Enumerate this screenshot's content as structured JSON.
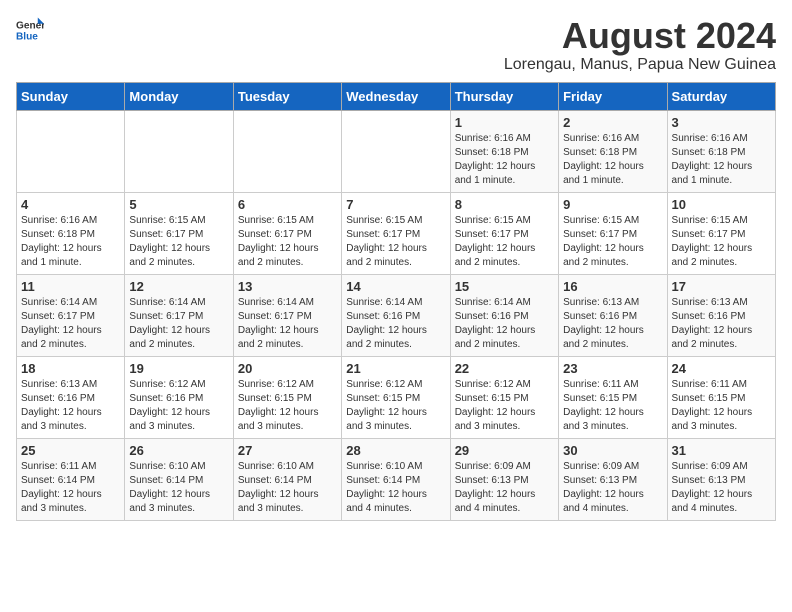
{
  "logo": {
    "general": "General",
    "blue": "Blue"
  },
  "title": "August 2024",
  "subtitle": "Lorengau, Manus, Papua New Guinea",
  "days_of_week": [
    "Sunday",
    "Monday",
    "Tuesday",
    "Wednesday",
    "Thursday",
    "Friday",
    "Saturday"
  ],
  "weeks": [
    [
      {
        "day": "",
        "info": ""
      },
      {
        "day": "",
        "info": ""
      },
      {
        "day": "",
        "info": ""
      },
      {
        "day": "",
        "info": ""
      },
      {
        "day": "1",
        "info": "Sunrise: 6:16 AM\nSunset: 6:18 PM\nDaylight: 12 hours\nand 1 minute."
      },
      {
        "day": "2",
        "info": "Sunrise: 6:16 AM\nSunset: 6:18 PM\nDaylight: 12 hours\nand 1 minute."
      },
      {
        "day": "3",
        "info": "Sunrise: 6:16 AM\nSunset: 6:18 PM\nDaylight: 12 hours\nand 1 minute."
      }
    ],
    [
      {
        "day": "4",
        "info": "Sunrise: 6:16 AM\nSunset: 6:18 PM\nDaylight: 12 hours\nand 1 minute."
      },
      {
        "day": "5",
        "info": "Sunrise: 6:15 AM\nSunset: 6:17 PM\nDaylight: 12 hours\nand 2 minutes."
      },
      {
        "day": "6",
        "info": "Sunrise: 6:15 AM\nSunset: 6:17 PM\nDaylight: 12 hours\nand 2 minutes."
      },
      {
        "day": "7",
        "info": "Sunrise: 6:15 AM\nSunset: 6:17 PM\nDaylight: 12 hours\nand 2 minutes."
      },
      {
        "day": "8",
        "info": "Sunrise: 6:15 AM\nSunset: 6:17 PM\nDaylight: 12 hours\nand 2 minutes."
      },
      {
        "day": "9",
        "info": "Sunrise: 6:15 AM\nSunset: 6:17 PM\nDaylight: 12 hours\nand 2 minutes."
      },
      {
        "day": "10",
        "info": "Sunrise: 6:15 AM\nSunset: 6:17 PM\nDaylight: 12 hours\nand 2 minutes."
      }
    ],
    [
      {
        "day": "11",
        "info": "Sunrise: 6:14 AM\nSunset: 6:17 PM\nDaylight: 12 hours\nand 2 minutes."
      },
      {
        "day": "12",
        "info": "Sunrise: 6:14 AM\nSunset: 6:17 PM\nDaylight: 12 hours\nand 2 minutes."
      },
      {
        "day": "13",
        "info": "Sunrise: 6:14 AM\nSunset: 6:17 PM\nDaylight: 12 hours\nand 2 minutes."
      },
      {
        "day": "14",
        "info": "Sunrise: 6:14 AM\nSunset: 6:16 PM\nDaylight: 12 hours\nand 2 minutes."
      },
      {
        "day": "15",
        "info": "Sunrise: 6:14 AM\nSunset: 6:16 PM\nDaylight: 12 hours\nand 2 minutes."
      },
      {
        "day": "16",
        "info": "Sunrise: 6:13 AM\nSunset: 6:16 PM\nDaylight: 12 hours\nand 2 minutes."
      },
      {
        "day": "17",
        "info": "Sunrise: 6:13 AM\nSunset: 6:16 PM\nDaylight: 12 hours\nand 2 minutes."
      }
    ],
    [
      {
        "day": "18",
        "info": "Sunrise: 6:13 AM\nSunset: 6:16 PM\nDaylight: 12 hours\nand 3 minutes."
      },
      {
        "day": "19",
        "info": "Sunrise: 6:12 AM\nSunset: 6:16 PM\nDaylight: 12 hours\nand 3 minutes."
      },
      {
        "day": "20",
        "info": "Sunrise: 6:12 AM\nSunset: 6:15 PM\nDaylight: 12 hours\nand 3 minutes."
      },
      {
        "day": "21",
        "info": "Sunrise: 6:12 AM\nSunset: 6:15 PM\nDaylight: 12 hours\nand 3 minutes."
      },
      {
        "day": "22",
        "info": "Sunrise: 6:12 AM\nSunset: 6:15 PM\nDaylight: 12 hours\nand 3 minutes."
      },
      {
        "day": "23",
        "info": "Sunrise: 6:11 AM\nSunset: 6:15 PM\nDaylight: 12 hours\nand 3 minutes."
      },
      {
        "day": "24",
        "info": "Sunrise: 6:11 AM\nSunset: 6:15 PM\nDaylight: 12 hours\nand 3 minutes."
      }
    ],
    [
      {
        "day": "25",
        "info": "Sunrise: 6:11 AM\nSunset: 6:14 PM\nDaylight: 12 hours\nand 3 minutes."
      },
      {
        "day": "26",
        "info": "Sunrise: 6:10 AM\nSunset: 6:14 PM\nDaylight: 12 hours\nand 3 minutes."
      },
      {
        "day": "27",
        "info": "Sunrise: 6:10 AM\nSunset: 6:14 PM\nDaylight: 12 hours\nand 3 minutes."
      },
      {
        "day": "28",
        "info": "Sunrise: 6:10 AM\nSunset: 6:14 PM\nDaylight: 12 hours\nand 4 minutes."
      },
      {
        "day": "29",
        "info": "Sunrise: 6:09 AM\nSunset: 6:13 PM\nDaylight: 12 hours\nand 4 minutes."
      },
      {
        "day": "30",
        "info": "Sunrise: 6:09 AM\nSunset: 6:13 PM\nDaylight: 12 hours\nand 4 minutes."
      },
      {
        "day": "31",
        "info": "Sunrise: 6:09 AM\nSunset: 6:13 PM\nDaylight: 12 hours\nand 4 minutes."
      }
    ]
  ]
}
